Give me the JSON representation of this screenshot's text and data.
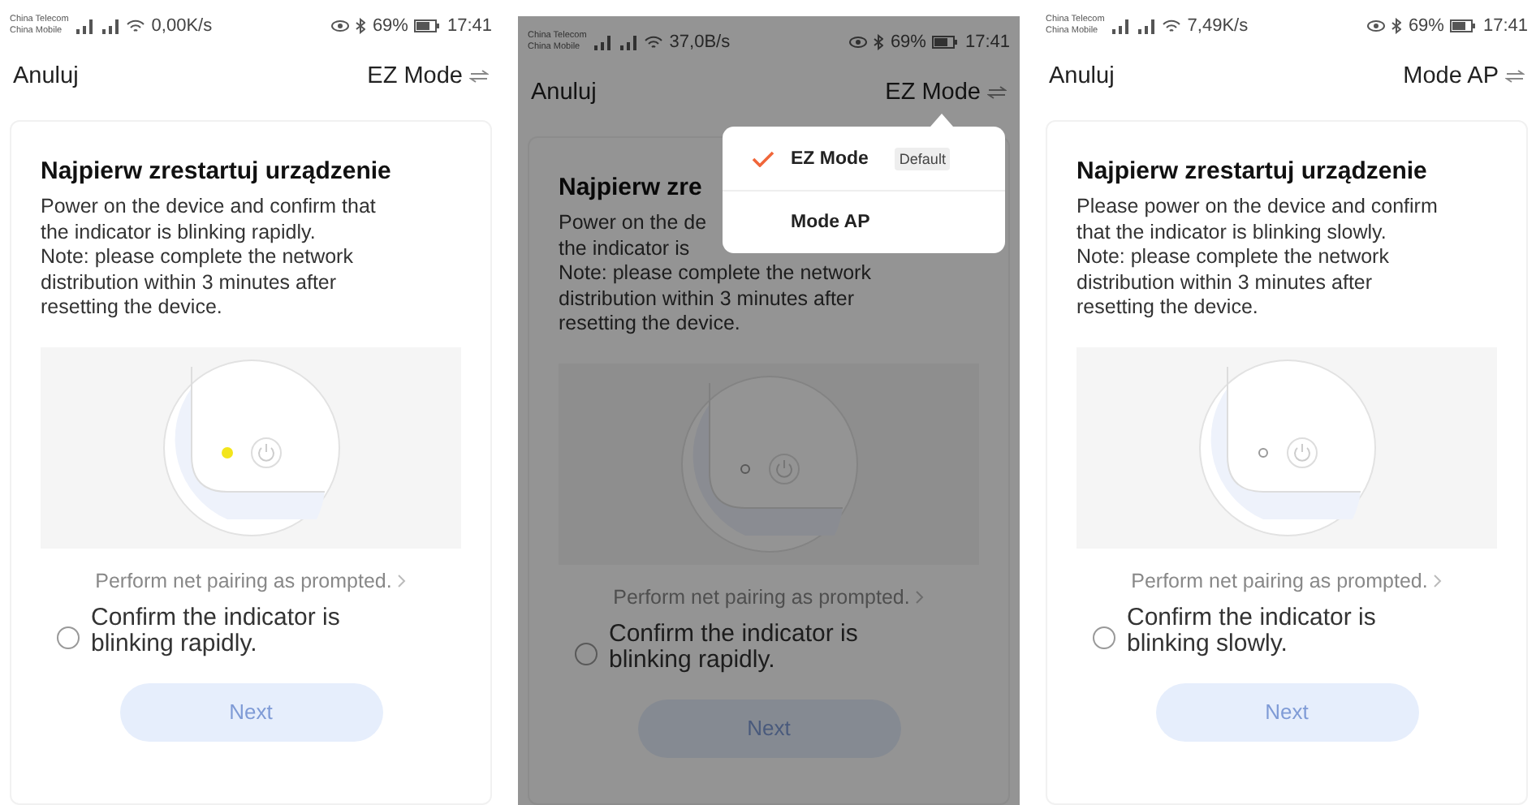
{
  "phones": [
    {
      "status_bar": {
        "carriers": [
          "China Telecom",
          "China Mobile"
        ],
        "speed": "0,00K/s",
        "battery": "69%",
        "time": "17:41"
      },
      "nav": {
        "cancel": "Anuluj",
        "mode": "EZ Mode"
      },
      "dimmed": false,
      "title": "Najpierw zrestartuj urządzenie",
      "description_lines": [
        "Power on the device and confirm that",
        "the indicator is blinking rapidly.",
        "Note: please complete the network",
        "distribution within 3 minutes after",
        "resetting the device."
      ],
      "indicator_lit": true,
      "link": "Perform net pairing as prompted.",
      "confirm": {
        "label": "Confirm the indicator is blinking rapidly.",
        "checked": false
      },
      "next_button": {
        "label": "Next",
        "disabled": true
      }
    },
    {
      "status_bar": {
        "carriers": [
          "China Telecom",
          "China Mobile"
        ],
        "speed": "37,0B/s",
        "battery": "69%",
        "time": "17:41"
      },
      "nav": {
        "cancel": "Anuluj",
        "mode": "EZ Mode"
      },
      "dimmed": true,
      "title": "Najpierw zre",
      "description_lines": [
        "Power on the de",
        "the indicator is",
        "Note: please complete the network",
        "distribution within 3 minutes after",
        "resetting the device."
      ],
      "indicator_lit": false,
      "link": "Perform net pairing as prompted.",
      "confirm": {
        "label": "Confirm the indicator is blinking rapidly.",
        "checked": false
      },
      "next_button": {
        "label": "Next",
        "disabled": true
      },
      "mode_menu": [
        {
          "label": "EZ Mode",
          "badge": "Default",
          "selected": true
        },
        {
          "label": "Mode AP",
          "selected": false
        }
      ]
    },
    {
      "status_bar": {
        "carriers": [
          "China Telecom",
          "China Mobile"
        ],
        "speed": "7,49K/s",
        "battery": "69%",
        "time": "17:41"
      },
      "nav": {
        "cancel": "Anuluj",
        "mode": "Mode AP"
      },
      "dimmed": false,
      "title": "Najpierw zrestartuj urządzenie",
      "description_lines": [
        "Please power on the device and confirm",
        "that the indicator is blinking slowly.",
        "Note: please complete the network",
        "distribution within 3 minutes after",
        "resetting the device."
      ],
      "indicator_lit": false,
      "link": "Perform net pairing as prompted.",
      "confirm": {
        "label": "Confirm the indicator is blinking slowly.",
        "checked": false
      },
      "next_button": {
        "label": "Next",
        "disabled": true
      }
    }
  ]
}
